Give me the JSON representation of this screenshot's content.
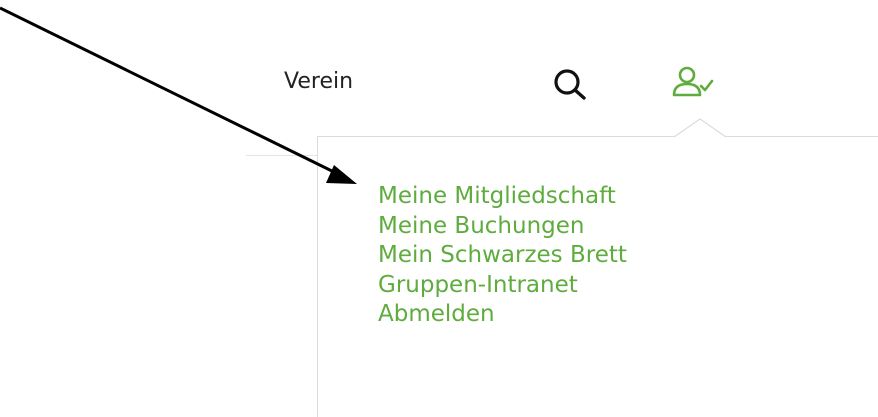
{
  "header": {
    "nav_label": "Verein",
    "icons": {
      "search": "search-icon",
      "user": "user-check-icon"
    }
  },
  "user_menu": {
    "items": [
      {
        "label": "Meine Mitgliedschaft"
      },
      {
        "label": "Meine Buchungen"
      },
      {
        "label": "Mein Schwarzes Brett"
      },
      {
        "label": "Gruppen-Intranet"
      },
      {
        "label": "Abmelden"
      }
    ]
  },
  "colors": {
    "accent": "#5fac3e",
    "text": "#222222",
    "arrow": "#000000"
  }
}
